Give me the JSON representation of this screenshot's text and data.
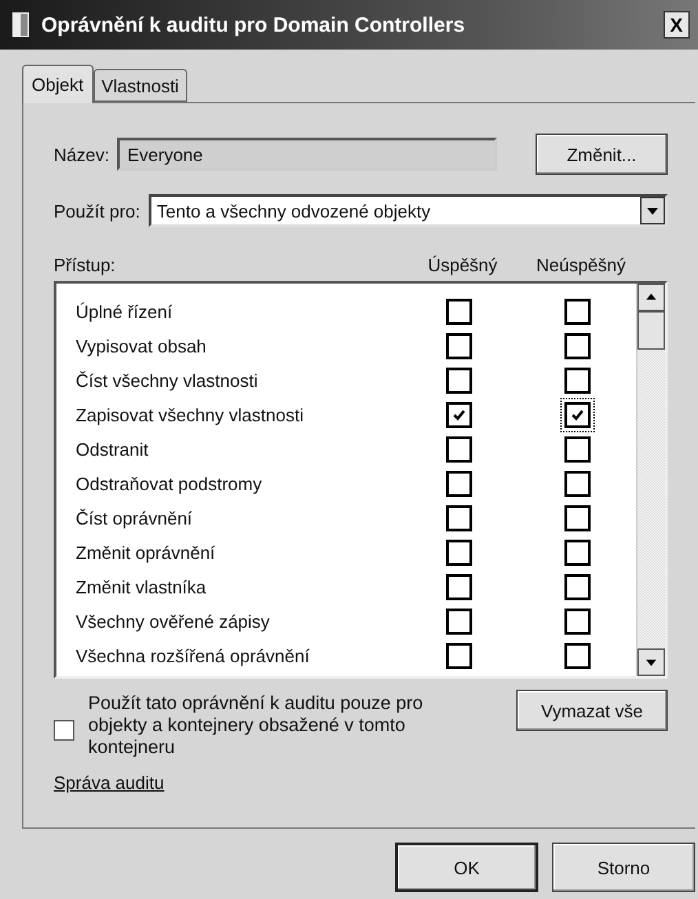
{
  "window": {
    "title": "Oprávnění k auditu pro Domain Controllers",
    "close": "X"
  },
  "tabs": [
    {
      "label": "Objekt",
      "selected": true
    },
    {
      "label": "Vlastnosti",
      "selected": false
    }
  ],
  "name": {
    "label": "Název:",
    "value": "Everyone",
    "button": "Změnit..."
  },
  "apply_to": {
    "label": "Použít pro:",
    "value": "Tento a všechny odvozené objekty"
  },
  "permissions": {
    "columns": [
      "Přístup:",
      "Úspěšný",
      "Neúspěšný"
    ],
    "rows": [
      {
        "name": "Úplné řízení",
        "success": false,
        "failure": false
      },
      {
        "name": "Vypisovat obsah",
        "success": false,
        "failure": false
      },
      {
        "name": "Číst všechny vlastnosti",
        "success": false,
        "failure": false
      },
      {
        "name": "Zapisovat všechny vlastnosti",
        "success": true,
        "failure": true,
        "focused": true
      },
      {
        "name": "Odstranit",
        "success": false,
        "failure": false
      },
      {
        "name": "Odstraňovat podstromy",
        "success": false,
        "failure": false
      },
      {
        "name": "Číst oprávnění",
        "success": false,
        "failure": false
      },
      {
        "name": "Změnit oprávnění",
        "success": false,
        "failure": false
      },
      {
        "name": "Změnit vlastníka",
        "success": false,
        "failure": false
      },
      {
        "name": "Všechny ověřené zápisy",
        "success": false,
        "failure": false
      },
      {
        "name": "Všechna rozšířená oprávnění",
        "success": false,
        "failure": false
      }
    ]
  },
  "apply_only": {
    "label": "Použít tato oprávnění k auditu pouze pro objekty a kontejnery obsažené v tomto kontejneru",
    "checked": false
  },
  "clear_button": "Vymazat vše",
  "link": "Správa auditu",
  "buttons": [
    "OK",
    "Storno"
  ]
}
